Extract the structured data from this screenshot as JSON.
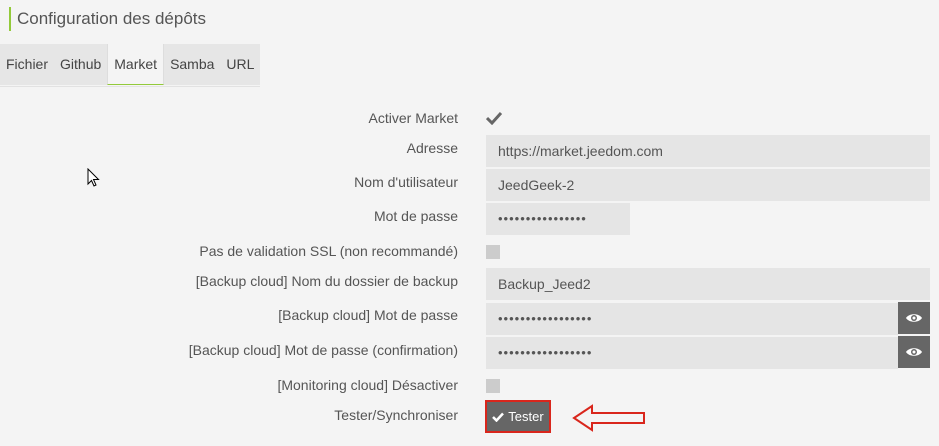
{
  "panel": {
    "title": "Configuration des dépôts"
  },
  "tabs": [
    {
      "label": "Fichier",
      "active": false
    },
    {
      "label": "Github",
      "active": false
    },
    {
      "label": "Market",
      "active": true
    },
    {
      "label": "Samba",
      "active": false
    },
    {
      "label": "URL",
      "active": false
    }
  ],
  "form": {
    "activer_market": {
      "label": "Activer Market",
      "checked": true
    },
    "adresse": {
      "label": "Adresse",
      "value": "https://market.jeedom.com"
    },
    "nom_utilisateur": {
      "label": "Nom d'utilisateur",
      "value": "JeedGeek-2"
    },
    "mot_de_passe": {
      "label": "Mot de passe",
      "value": "••••••••••••••••"
    },
    "ssl": {
      "label": "Pas de validation SSL (non recommandé)",
      "checked": false
    },
    "backup_dossier": {
      "label": "[Backup cloud] Nom du dossier de backup",
      "value": "Backup_Jeed2"
    },
    "backup_mdp": {
      "label": "[Backup cloud] Mot de passe",
      "value": "•••••••••••••••••"
    },
    "backup_mdp_conf": {
      "label": "[Backup cloud] Mot de passe (confirmation)",
      "value": "•••••••••••••••••"
    },
    "monitoring": {
      "label": "[Monitoring cloud] Désactiver",
      "checked": false
    },
    "tester": {
      "label": "Tester/Synchroniser",
      "button_label": "Tester"
    }
  },
  "colors": {
    "accent": "#93ca3a",
    "highlight": "#d9261c",
    "button": "#666666"
  }
}
